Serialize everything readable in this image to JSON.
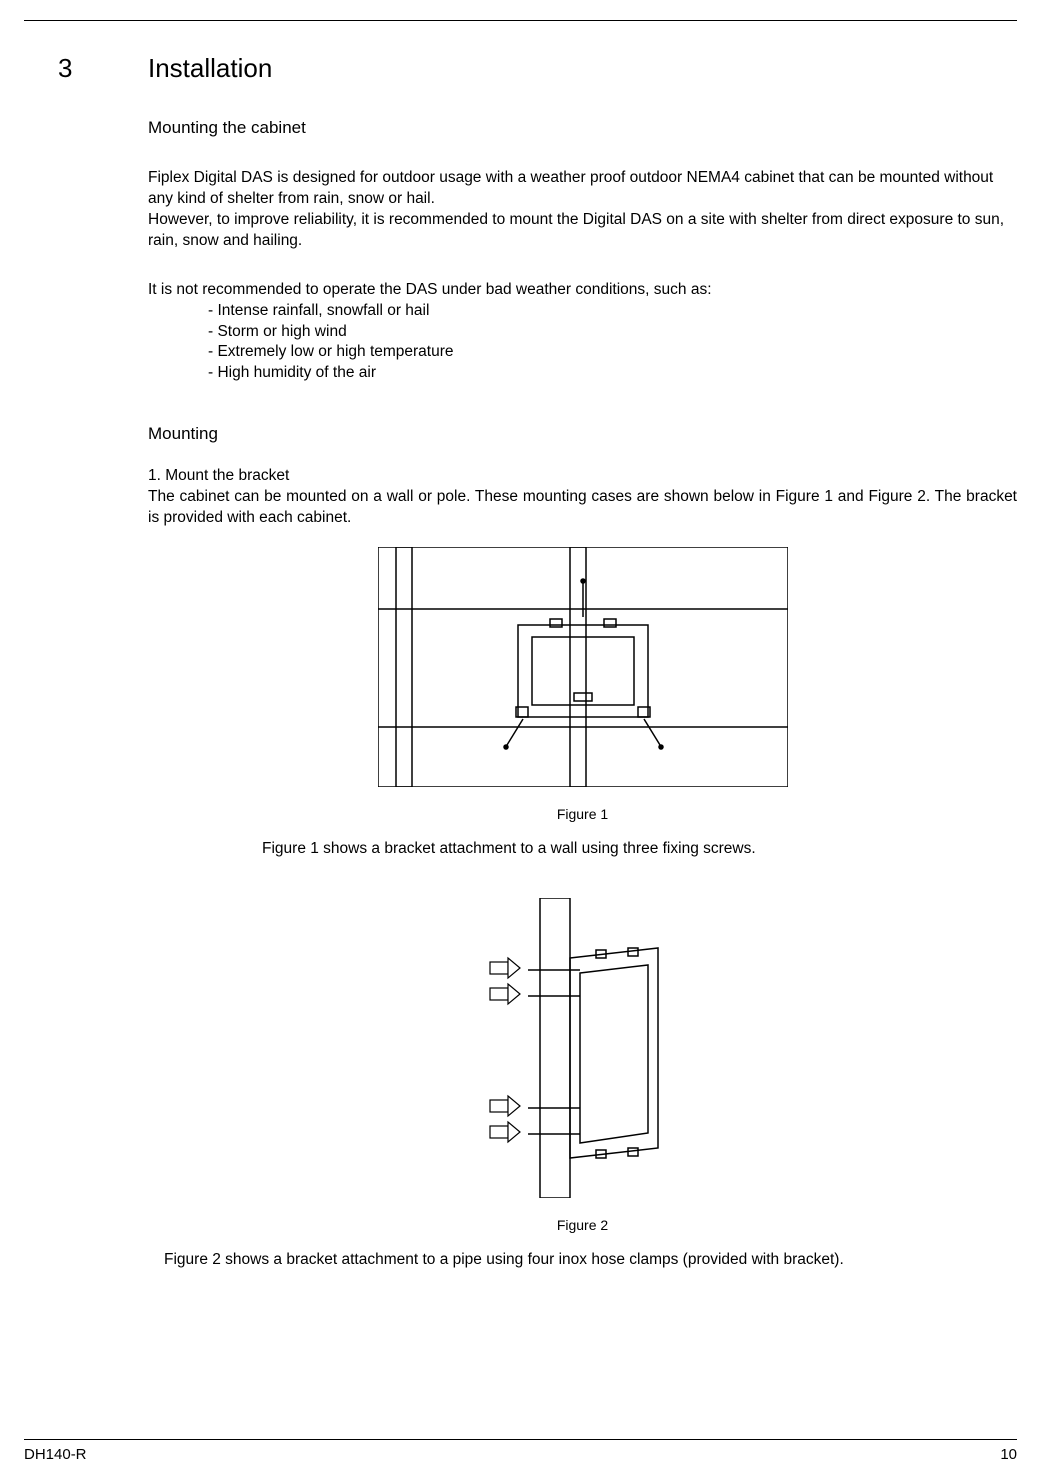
{
  "section": {
    "num": "3",
    "title": "Installation"
  },
  "sub1": "Mounting the cabinet",
  "p1": "Fiplex Digital DAS is designed for outdoor usage with a weather proof outdoor NEMA4 cabinet that can be mounted without any kind of shelter from rain, snow or hail.",
  "p2": "However, to improve reliability, it is recommended to mount the Digital DAS on a site with shelter from direct exposure to sun, rain, snow and hailing.",
  "p3": "It is not recommended to operate the DAS under bad weather conditions, such as:",
  "bullets": {
    "b1": "- Intense rainfall, snowfall or hail",
    "b2": "- Storm or high wind",
    "b3": "- Extremely low or high temperature",
    "b4": "- High humidity of the air"
  },
  "sub2": "Mounting",
  "step1_title": "1. Mount the bracket",
  "step1_body": "The cabinet can be mounted on a wall or pole. These mounting cases are shown below in Figure 1 and Figure 2. The bracket is provided with each cabinet.",
  "fig1_caption": "Figure 1",
  "fig1_desc": "Figure 1 shows a bracket attachment to a wall using three fixing screws.",
  "fig2_caption": "Figure 2",
  "fig2_desc": "Figure 2 shows a bracket attachment to a pipe using four inox hose clamps (provided with bracket).",
  "footer": {
    "left": "DH140-R",
    "right": "10"
  }
}
